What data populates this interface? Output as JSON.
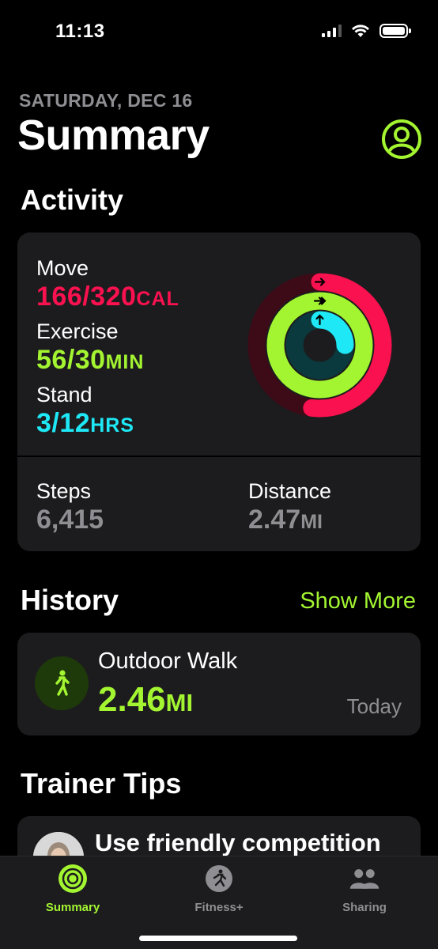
{
  "status_bar": {
    "time": "11:13"
  },
  "header": {
    "date": "SATURDAY, DEC 16",
    "title": "Summary"
  },
  "activity": {
    "title": "Activity",
    "move": {
      "label": "Move",
      "value": "166/320",
      "unit": "CAL",
      "progress": 0.52,
      "color": "#fa114f"
    },
    "exercise": {
      "label": "Exercise",
      "value": "56/30",
      "unit": "MIN",
      "progress": 1.87,
      "color": "#a3f531"
    },
    "stand": {
      "label": "Stand",
      "value": "3/12",
      "unit": "HRS",
      "progress": 0.25,
      "color": "#1ee8f5"
    },
    "steps": {
      "label": "Steps",
      "value": "6,415"
    },
    "distance": {
      "label": "Distance",
      "value": "2.47",
      "unit": "MI"
    }
  },
  "history": {
    "title": "History",
    "show_more": "Show More",
    "workout": {
      "icon": "walking-figure-icon",
      "name": "Outdoor Walk",
      "value": "2.46",
      "unit": "MI",
      "date": "Today"
    }
  },
  "trainer_tips": {
    "title": "Trainer Tips",
    "tip_title": "Use friendly competition"
  },
  "tab_bar": {
    "tabs": [
      {
        "label": "Summary",
        "icon": "activity-rings-icon",
        "active": true
      },
      {
        "label": "Fitness+",
        "icon": "running-figure-icon",
        "active": false
      },
      {
        "label": "Sharing",
        "icon": "people-icon",
        "active": false
      }
    ]
  },
  "colors": {
    "accent": "#a3f531",
    "background": "#000000",
    "card": "#1c1c1e",
    "secondary_text": "#8e8e93"
  }
}
